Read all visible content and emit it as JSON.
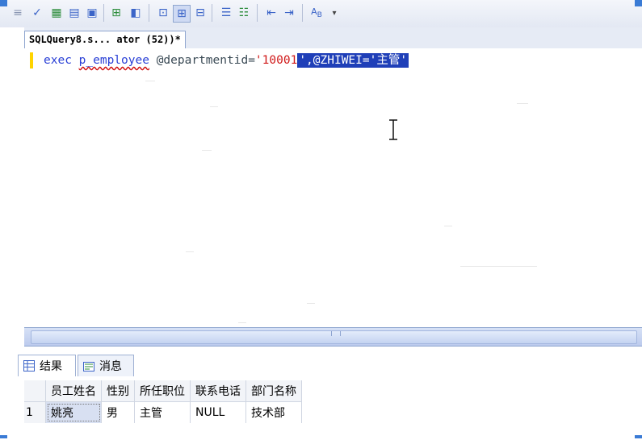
{
  "toolbar": {
    "icons": [
      "grip-icon",
      "check-icon",
      "parse-icon",
      "display-plan-icon",
      "results-to-grid-icon",
      "include-plan-icon",
      "client-stats-icon",
      "results-text-icon",
      "results-grid-icon",
      "results-file-icon",
      "comment-icon",
      "uncomment-icon",
      "decrease-indent-icon",
      "increase-indent-icon",
      "specify-values-icon",
      "overflow-chevron-icon"
    ]
  },
  "tab": {
    "title": "SQLQuery8.s... ator (52))*"
  },
  "editor": {
    "keyword": "exec",
    "procedure": "p_employee",
    "param1": "@departmentid=",
    "value1": "'10001",
    "selected_text": "',@ZHIWEI='主管'"
  },
  "results": {
    "tabs": [
      {
        "label": "结果",
        "icon": "grid-icon"
      },
      {
        "label": "消息",
        "icon": "messages-icon"
      }
    ],
    "columns": [
      "员工姓名",
      "性别",
      "所任职位",
      "联系电话",
      "部门名称"
    ],
    "rows": [
      {
        "num": "1",
        "cells": [
          "姚亮",
          "男",
          "主管",
          "NULL",
          "技术部"
        ]
      }
    ]
  },
  "colors": {
    "selection": "#1f3fb8",
    "string": "#d01818",
    "keyword": "#2a40d6"
  }
}
